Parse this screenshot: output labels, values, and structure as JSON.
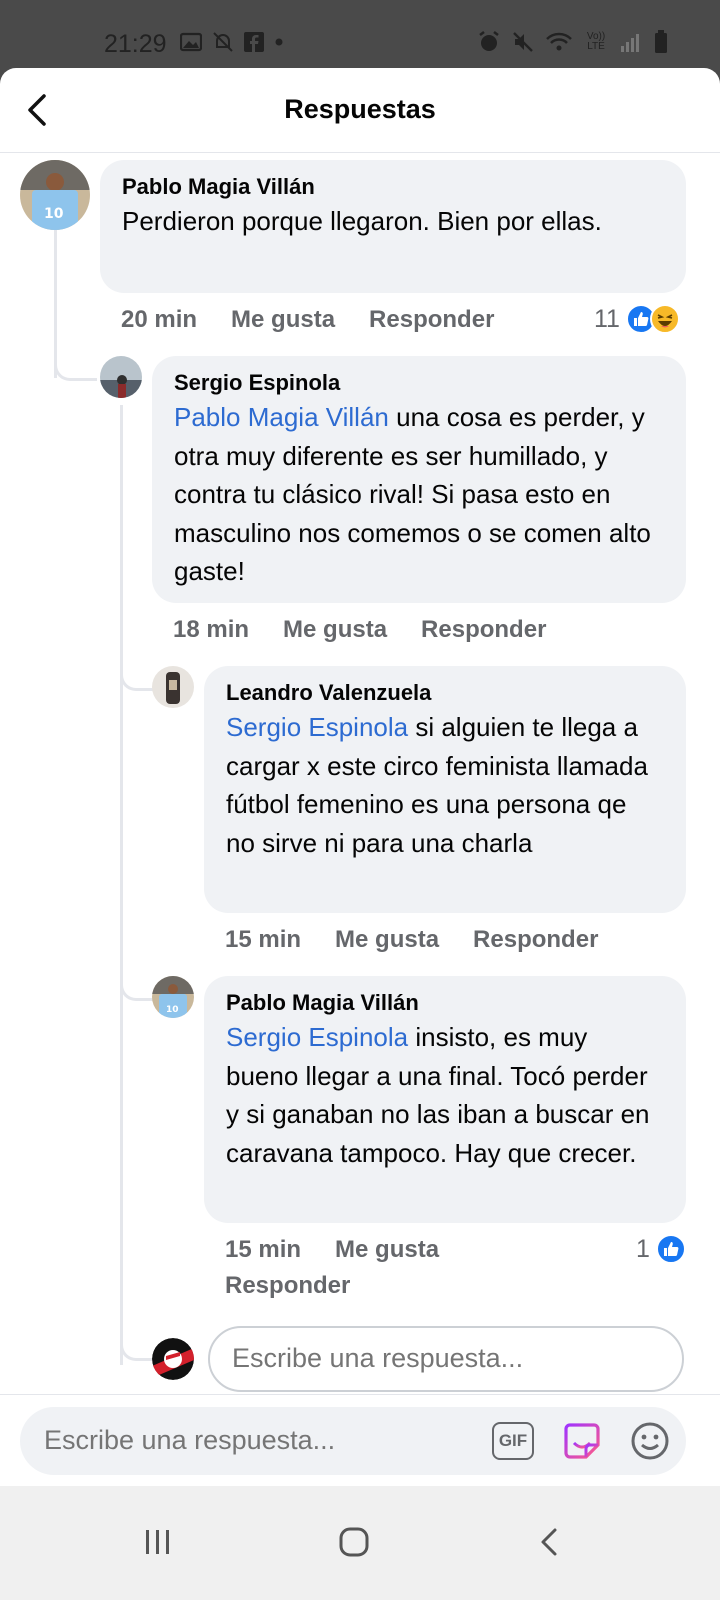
{
  "status_bar": {
    "time": "21:29",
    "left_icons": [
      "image-icon",
      "notifications-off-icon",
      "facebook-icon",
      "dot-icon"
    ],
    "right_icons": [
      "alarm-icon",
      "mute-icon",
      "wifi-icon",
      "volte-icon",
      "signal-icon",
      "battery-icon"
    ],
    "volte_label": "Vo)) LTE"
  },
  "header": {
    "title": "Respuestas"
  },
  "comments": [
    {
      "author": "Pablo Magia Villán",
      "mention": "",
      "text": "Perdieron porque llegaron. Bien por ellas.",
      "time": "20 min",
      "like_label": "Me gusta",
      "reply_label": "Responder",
      "reaction_count": "11",
      "reactions": [
        "like-icon",
        "haha-icon"
      ]
    },
    {
      "author": "Sergio Espinola",
      "mention": "Pablo Magia Villán",
      "text": " una cosa es perder, y otra muy diferente es ser humillado, y contra tu clásico rival! Si pasa esto en masculino nos comemos o se comen alto gaste!",
      "time": "18 min",
      "like_label": "Me gusta",
      "reply_label": "Responder"
    },
    {
      "author": "Leandro Valenzuela",
      "mention": "Sergio Espinola",
      "text": " si alguien te llega a cargar x este circo feminista llamada fútbol femenino es una persona qe no sirve ni para una charla",
      "time": "15 min",
      "like_label": "Me gusta",
      "reply_label": "Responder"
    },
    {
      "author": "Pablo Magia Villán",
      "mention": "Sergio Espinola",
      "text": " insisto, es muy bueno llegar a una final. Tocó perder y si ganaban no las iban a buscar en caravana tampoco. Hay que crecer.",
      "time": "15 min",
      "like_label": "Me gusta",
      "reply_label": "Responder",
      "reaction_count": "1",
      "reactions": [
        "like-icon"
      ]
    }
  ],
  "reply_box": {
    "placeholder": "Escribe una respuesta..."
  },
  "composer": {
    "placeholder": "Escribe una respuesta...",
    "gif_label": "GIF",
    "icons": [
      "gif-icon",
      "sticker-icon",
      "emoji-icon"
    ]
  },
  "nav_bar": {
    "buttons": [
      "recents-icon",
      "home-icon",
      "back-icon"
    ]
  },
  "colors": {
    "mention": "#2d6bd1",
    "like_blue": "#1877f2",
    "bubble_bg": "#f0f2f5",
    "meta_gray": "#65676b"
  }
}
